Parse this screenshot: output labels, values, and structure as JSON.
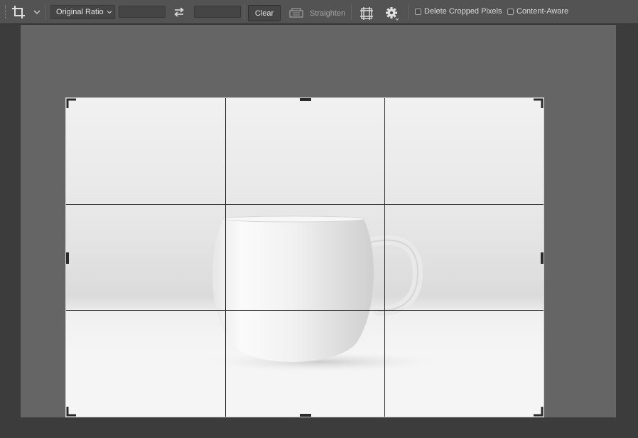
{
  "toolbar": {
    "crop_tool_icon": "crop-icon",
    "ratio_select": {
      "value": "Original Ratio"
    },
    "width_field": {
      "value": ""
    },
    "height_field": {
      "value": ""
    },
    "swap_icon": "swap-arrows-icon",
    "clear_label": "Clear",
    "straighten_label": "Straighten",
    "grid_overlay_icon": "grid-overlay-icon",
    "settings_icon": "gear-icon",
    "delete_cropped_pixels": {
      "label": "Delete Cropped Pixels",
      "checked": false
    },
    "content_aware": {
      "label": "Content-Aware",
      "checked": false
    }
  },
  "canvas": {
    "image": "white-mug-photo",
    "crop_overlay": "rule-of-thirds"
  },
  "colors": {
    "toolbar_bg": "#535353",
    "workspace_bg": "#3c3c3c",
    "canvas_bg": "#656565",
    "grid_line": "#2b2b2b"
  }
}
